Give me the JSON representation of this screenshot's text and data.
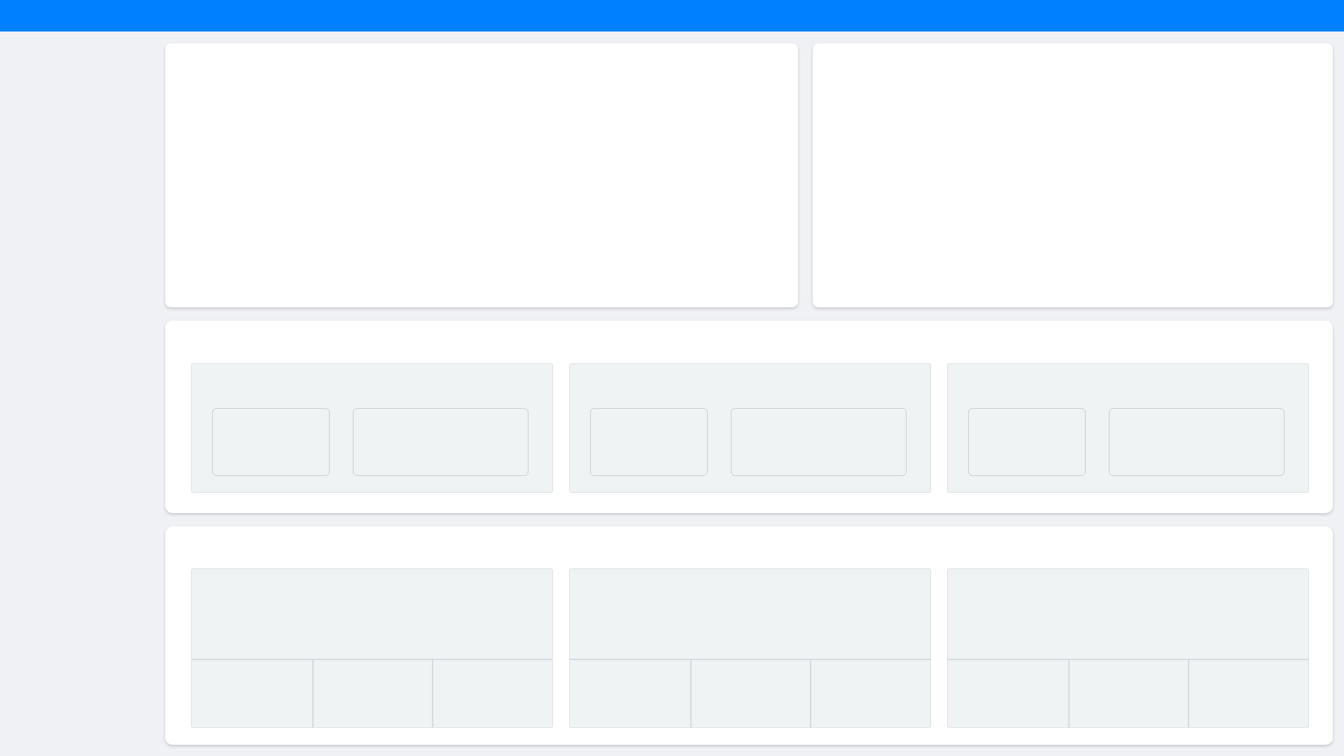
{
  "rows": [
    {
      "kind": "panels",
      "items": [
        {
          "kind": "blank"
        },
        {
          "kind": "blank"
        }
      ]
    },
    {
      "kind": "card",
      "items": [
        {
          "kind": "pair"
        },
        {
          "kind": "pair"
        },
        {
          "kind": "pair"
        }
      ]
    },
    {
      "kind": "card",
      "items": [
        {
          "kind": "grid"
        },
        {
          "kind": "grid"
        },
        {
          "kind": "grid"
        }
      ]
    }
  ]
}
